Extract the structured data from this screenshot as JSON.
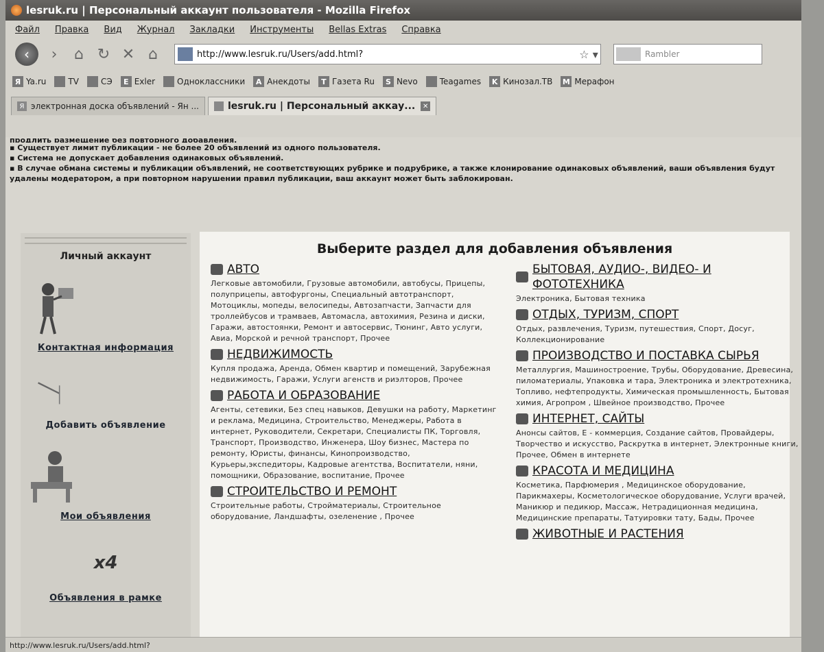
{
  "window": {
    "title": "lesruk.ru | Персональный аккаунт пользователя - Mozilla Firefox"
  },
  "menu": [
    "Файл",
    "Правка",
    "Вид",
    "Журнал",
    "Закладки",
    "Инструменты",
    "Bellas Extras",
    "Справка"
  ],
  "nav": {
    "url": "http://www.lesruk.ru/Users/add.html?",
    "search_placeholder": "Rambler"
  },
  "bookmarks": [
    "Ya.ru",
    "TV",
    "СЭ",
    "Exler",
    "Одноклассники",
    "Анекдоты",
    "Газета Ru",
    "Nevo",
    "Teagames",
    "Кинозал.ТВ",
    "Мерафон"
  ],
  "tabs": [
    {
      "label": "электронная доска объявлений - Ян ..."
    },
    {
      "label": "lesruk.ru | Персональный аккау..."
    }
  ],
  "notices": {
    "cut_line": "продлить размещение без повторного добавления.",
    "lines": [
      "Существует лимит публикации - не более 20 объявлений из одного пользователя.",
      "Система не допускает добавления одинаковых объявлений.",
      "В случае обмана системы и публикации объявлений, не соответствующих рубрике и подрубрике, а также клонирование одинаковых объявлений, ваши объявления будут удалены модератором, а при повторном нарушении правил публикации, ваш аккаунт может быть заблокирован."
    ]
  },
  "sidebar": {
    "title": "Личный аккаунт",
    "items": [
      {
        "label": "Контактная информация",
        "link": true
      },
      {
        "label": "Добавить объявление",
        "link": false
      },
      {
        "label": "Мои объявления",
        "link": true
      },
      {
        "label": "Объявления в рамке",
        "link": true
      }
    ],
    "badge": "x4"
  },
  "main": {
    "heading": "Выберите раздел для добавления объявления",
    "left": [
      {
        "title": "АВТО",
        "desc": "Легковые автомобили, Грузовые автомобили, автобусы, Прицепы, полуприцепы, автофургоны, Специальный автотранспорт, Мотоциклы, мопеды, велосипеды, Автозапчасти, Запчасти для троллейбусов и трамваев, Автомасла, автохимия, Резина и диски, Гаражи, автостоянки, Ремонт и автосервис, Тюнинг, Авто услуги, Авиа, Морской и речной транспорт, Прочее"
      },
      {
        "title": "НЕДВИЖИМОСТЬ",
        "desc": "Купля продажа, Аренда, Обмен квартир и помещений, Зарубежная недвижимость, Гаражи, Услуги агенств и риэлторов, Прочее"
      },
      {
        "title": "РАБОТА И ОБРАЗОВАНИЕ",
        "desc": "Агенты, сетевики, Без спец навыков, Девушки на работу, Маркетинг и реклама, Медицина, Строительство, Менеджеры, Работа в интернет, Руководители, Секретари, Специалисты ПК, Торговля, Транспорт, Производство, Инженера, Шоу бизнес, Мастера по ремонту, Юристы, финансы, Кинопроизводство, Курьеры,экспедиторы, Кадровые агентства, Воспитатели, няни, помощники, Образование, воспитание, Прочее"
      },
      {
        "title": "СТРОИТЕЛЬСТВО И РЕМОНТ",
        "desc": "Строительные работы, Стройматериалы, Строительное оборудование, Ландшафты, озеленение , Прочее"
      }
    ],
    "right": [
      {
        "title": "БЫТОВАЯ, АУДИО-, ВИДЕО- И ФОТОТЕХНИКА",
        "desc": "Электроника, Бытовая техника"
      },
      {
        "title": "ОТДЫХ, ТУРИЗМ, СПОРТ",
        "desc": "Отдых, развлечения, Туризм, путешествия, Спорт, Досуг, Коллекционирование"
      },
      {
        "title": "ПРОИЗВОДСТВО И ПОСТАВКА СЫРЬЯ",
        "desc": "Металлургия, Машиностроение, Трубы, Оборудование, Древесина, пиломатериалы, Упаковка и тара, Электроника и электротехника, Топливо, нефтепродукты, Химическая промышленность, Бытовая химия, Агропром , Швейное производство, Прочее"
      },
      {
        "title": "ИНТЕРНЕТ, САЙТЫ",
        "desc": "Анонсы сайтов, E - коммерция, Создание сайтов, Провайдеры, Творчество и искусство, Раскрутка в интернет, Электронные книги, Прочее, Обмен в интернете"
      },
      {
        "title": "КРАСОТА И МЕДИЦИНА",
        "desc": "Косметика, Парфюмерия , Медицинское оборудование, Парикмахеры, Косметологическое оборудование, Услуги врачей, Маникюр и педикюр, Массаж, Нетрадиционная медицина, Медицинские препараты, Татуировки тату, Бады, Прочее"
      },
      {
        "title": "ЖИВОТНЫЕ И РАСТЕНИЯ",
        "desc": ""
      }
    ]
  },
  "status": "http://www.lesruk.ru/Users/add.html?"
}
